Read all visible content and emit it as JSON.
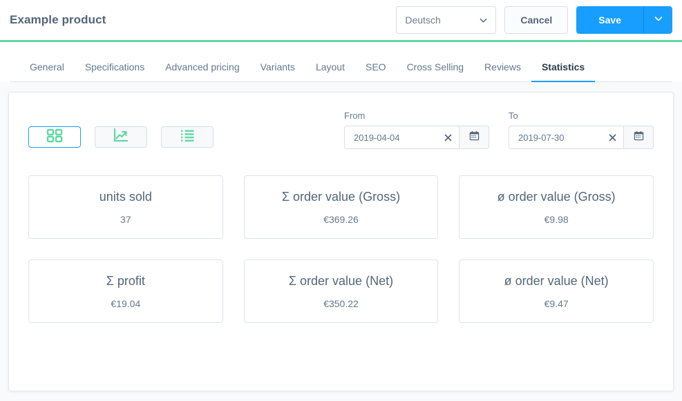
{
  "header": {
    "title": "Example product",
    "language_select": {
      "value": "Deutsch",
      "icon": "chevron-down-icon"
    },
    "cancel_label": "Cancel",
    "save_label": "Save",
    "save_caret_icon": "chevron-down-icon",
    "accent_color": "#5fd8a4",
    "primary_color": "#189eff"
  },
  "tabs": [
    {
      "label": "General",
      "active": false
    },
    {
      "label": "Specifications",
      "active": false
    },
    {
      "label": "Advanced pricing",
      "active": false
    },
    {
      "label": "Variants",
      "active": false
    },
    {
      "label": "Layout",
      "active": false
    },
    {
      "label": "SEO",
      "active": false
    },
    {
      "label": "Cross Selling",
      "active": false
    },
    {
      "label": "Reviews",
      "active": false
    },
    {
      "label": "Statistics",
      "active": true
    }
  ],
  "toolbar": {
    "view_buttons": [
      {
        "icon": "grid-view-icon",
        "active": true
      },
      {
        "icon": "line-chart-icon",
        "active": false
      },
      {
        "icon": "list-view-icon",
        "active": false
      }
    ],
    "icon_color": "#5fd8a4",
    "active_border_color": "#189eff"
  },
  "filters": {
    "from": {
      "label": "From",
      "value": "2019-04-04",
      "placeholder": "YYYY-MM-DD",
      "clear_icon": "close-icon",
      "calendar_icon": "calendar-icon"
    },
    "to": {
      "label": "To",
      "value": "2019-07-30",
      "placeholder": "YYYY-MM-DD",
      "clear_icon": "close-icon",
      "calendar_icon": "calendar-icon"
    }
  },
  "stats": [
    {
      "title": "units sold",
      "value": "37"
    },
    {
      "title": "Σ order value (Gross)",
      "value": "€369.26"
    },
    {
      "title": "ø order value (Gross)",
      "value": "€9.98"
    },
    {
      "title": "Σ profit",
      "value": "€19.04"
    },
    {
      "title": "Σ order value (Net)",
      "value": "€350.22"
    },
    {
      "title": "ø order value (Net)",
      "value": "€9.47"
    }
  ]
}
